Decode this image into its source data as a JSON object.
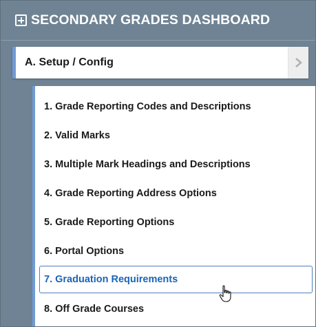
{
  "header": {
    "title": "SECONDARY GRADES DASHBOARD",
    "icon": "plus-box-icon"
  },
  "section": {
    "label": "A. Setup / Config",
    "icon": "chevron-right-icon"
  },
  "submenu": {
    "items": [
      {
        "label": "1. Grade Reporting Codes and Descriptions"
      },
      {
        "label": "2. Valid Marks"
      },
      {
        "label": "3. Multiple Mark Headings and Descriptions"
      },
      {
        "label": "4. Grade Reporting Address Options"
      },
      {
        "label": "5. Grade Reporting Options"
      },
      {
        "label": "6. Portal Options"
      },
      {
        "label": "7. Graduation Requirements"
      },
      {
        "label": "8. Off Grade Courses"
      }
    ],
    "active_item": "7. Graduation Requirements"
  },
  "colors": {
    "header_bg": "#6f8394",
    "accent": "#6f9bd6",
    "active_text": "#1a64b8",
    "text": "#1a1a1a"
  },
  "cursor": "hand-pointer-icon"
}
